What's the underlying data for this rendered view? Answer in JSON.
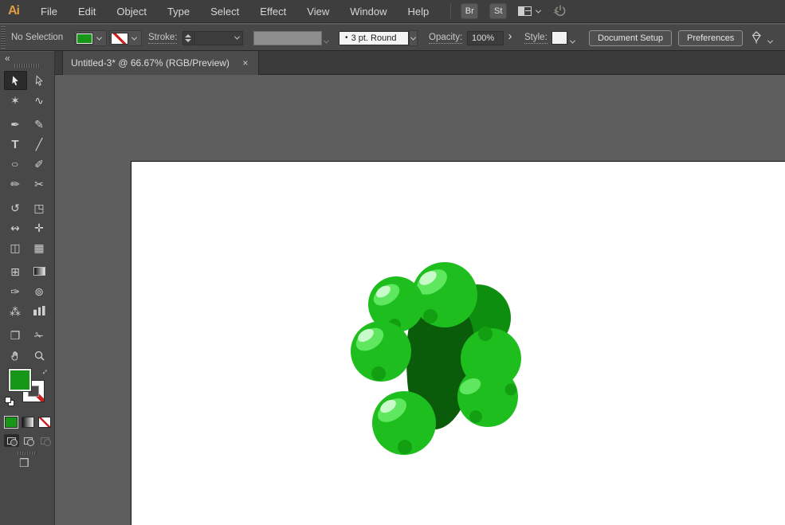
{
  "app": {
    "logo": "Ai",
    "name": "Adobe Illustrator"
  },
  "menubar": {
    "items": [
      "File",
      "Edit",
      "Object",
      "Type",
      "Select",
      "Effect",
      "View",
      "Window",
      "Help"
    ],
    "bridge_label": "Br",
    "stock_label": "St"
  },
  "control_bar": {
    "selection_status": "No Selection",
    "stroke_label": "Stroke:",
    "brush_bullet": "•",
    "brush_value": "3 pt. Round",
    "opacity_label": "Opacity:",
    "opacity_value": "100%",
    "opacity_expand": "›",
    "style_label": "Style:",
    "document_setup_label": "Document Setup",
    "preferences_label": "Preferences"
  },
  "tab": {
    "title": "Untitled-3* @ 66.67% (RGB/Preview)",
    "close_glyph": "×"
  },
  "toolbar": {
    "collapse_glyph": "«",
    "screen_mode_glyph": "❒",
    "swap_glyph": "↔",
    "tools": [
      {
        "name": "selection-tool",
        "icon": "cursor-filled",
        "active": true
      },
      {
        "name": "direct-selection-tool",
        "icon": "cursor-outline"
      },
      {
        "name": "magic-wand-tool",
        "glyph": "✶"
      },
      {
        "name": "lasso-tool",
        "glyph": "∿"
      },
      {
        "name": "pen-tool",
        "glyph": "✒"
      },
      {
        "name": "curvature-tool",
        "glyph": "✎"
      },
      {
        "name": "type-tool",
        "glyph": "T"
      },
      {
        "name": "line-segment-tool",
        "glyph": "╱"
      },
      {
        "name": "ellipse-tool",
        "glyph": "○"
      },
      {
        "name": "paintbrush-tool",
        "glyph": "✐"
      },
      {
        "name": "pencil-tool",
        "glyph": "✏"
      },
      {
        "name": "scissors-tool",
        "glyph": "✂"
      },
      {
        "name": "rotate-tool",
        "glyph": "↺"
      },
      {
        "name": "scale-tool",
        "glyph": "◳"
      },
      {
        "name": "width-tool",
        "glyph": "↭"
      },
      {
        "name": "free-transform-tool",
        "glyph": "✛"
      },
      {
        "name": "shape-builder-tool",
        "glyph": "◫"
      },
      {
        "name": "perspective-grid-tool",
        "glyph": "▦"
      },
      {
        "name": "mesh-tool",
        "glyph": "⊞"
      },
      {
        "name": "gradient-tool",
        "icon": "gradient-box"
      },
      {
        "name": "eyedropper-tool",
        "glyph": "✑"
      },
      {
        "name": "blend-tool",
        "glyph": "⊚"
      },
      {
        "name": "symbol-sprayer-tool",
        "glyph": "⁂"
      },
      {
        "name": "column-graph-tool",
        "icon": "bars-box"
      },
      {
        "name": "artboard-tool",
        "glyph": "❐"
      },
      {
        "name": "slice-tool",
        "glyph": "✁"
      },
      {
        "name": "hand-tool",
        "icon": "hand"
      },
      {
        "name": "zoom-tool",
        "icon": "zoom"
      }
    ],
    "group_starts": [
      4,
      5,
      12,
      13,
      18,
      19,
      24,
      25
    ]
  },
  "colors": {
    "menubar_bg": "#3e3e3e",
    "controlbar_bg": "#474747",
    "toolbar_bg": "#484848",
    "tabstrip_bg": "#3b3b3b",
    "tab_active_bg": "#4c4c4c",
    "pasteboard": "#5e5e5e",
    "canvas": "#ffffff",
    "fill_swatch_green": "#17971b",
    "stroke_none_red": "#cf1f1f",
    "logo_orange": "#e09b45"
  },
  "artwork": {
    "name": "green-sphere-cluster",
    "colors": {
      "body": "#1fbe1f",
      "body_shadow": "#12a012",
      "dark_ball": "#0e8e0e",
      "hole": "#0a5c0a",
      "highlight": "#5fe75f",
      "highlight_core": "#c9fac9"
    }
  }
}
